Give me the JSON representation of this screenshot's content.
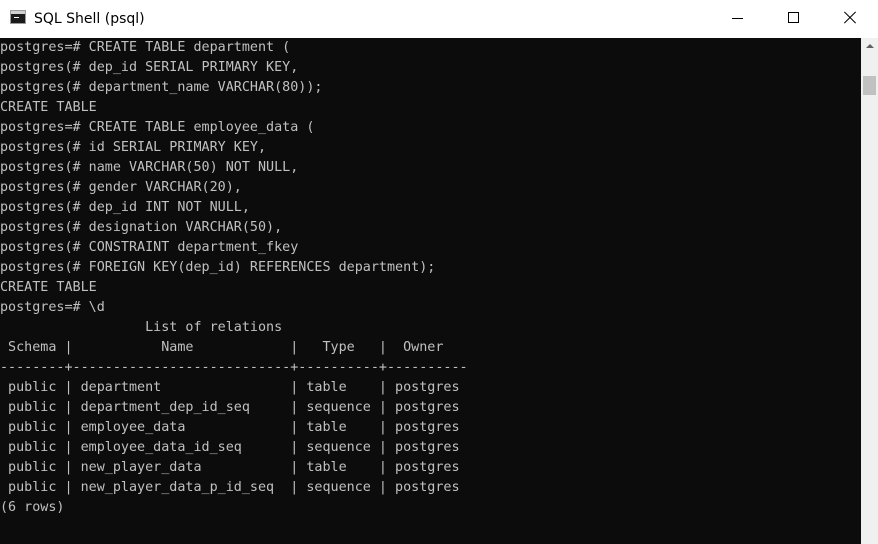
{
  "window": {
    "title": "SQL Shell (psql)",
    "icon": "console-icon",
    "controls": {
      "minimize": "minimize-icon",
      "maximize": "maximize-icon",
      "close": "close-icon"
    }
  },
  "console": {
    "lines": [
      "postgres=# CREATE TABLE department (",
      "postgres(# dep_id SERIAL PRIMARY KEY,",
      "postgres(# department_name VARCHAR(80));",
      "CREATE TABLE",
      "postgres=# CREATE TABLE employee_data (",
      "postgres(# id SERIAL PRIMARY KEY,",
      "postgres(# name VARCHAR(50) NOT NULL,",
      "postgres(# gender VARCHAR(20),",
      "postgres(# dep_id INT NOT NULL,",
      "postgres(# designation VARCHAR(50),",
      "postgres(# CONSTRAINT department_fkey",
      "postgres(# FOREIGN KEY(dep_id) REFERENCES department);",
      "CREATE TABLE",
      "postgres=# \\d",
      "                  List of relations",
      " Schema |           Name            |   Type   |  Owner",
      "--------+---------------------------+----------+----------",
      " public | department                | table    | postgres",
      " public | department_dep_id_seq     | sequence | postgres",
      " public | employee_data             | table    | postgres",
      " public | employee_data_id_seq      | sequence | postgres",
      " public | new_player_data           | table    | postgres",
      " public | new_player_data_p_id_seq  | sequence | postgres",
      "(6 rows)"
    ]
  },
  "colors": {
    "console_background": "#0c0c0c",
    "console_text": "#c0c0c0",
    "titlebar_background": "#ffffff"
  }
}
